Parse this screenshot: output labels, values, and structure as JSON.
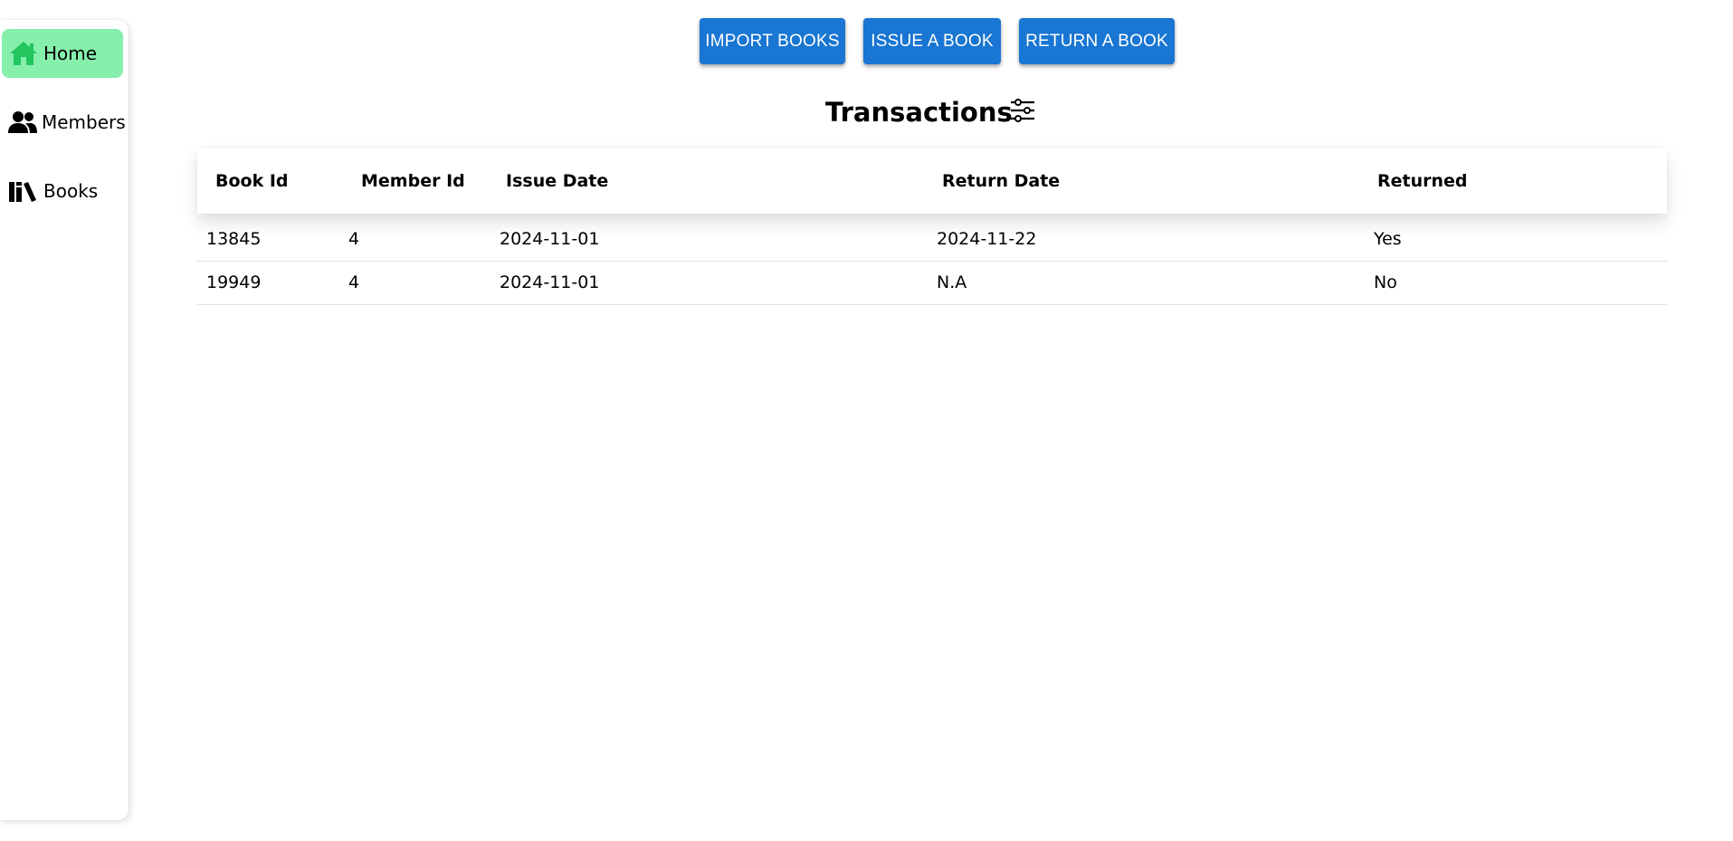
{
  "sidebar": {
    "items": [
      {
        "label": "Home",
        "icon": "home-icon",
        "active": true
      },
      {
        "label": "Members",
        "icon": "members-icon",
        "active": false
      },
      {
        "label": "Books",
        "icon": "books-icon",
        "active": false
      }
    ]
  },
  "toolbar": {
    "import_label": "IMPORT BOOKS",
    "issue_label": "ISSUE A BOOK",
    "return_label": "RETURN A BOOK"
  },
  "main": {
    "title": "Transactions",
    "filter_icon": "filter-sliders-icon"
  },
  "table": {
    "headers": [
      "Book Id",
      "Member Id",
      "Issue Date",
      "Return Date",
      "Returned"
    ],
    "rows": [
      [
        "13845",
        "4",
        "2024-11-01",
        "2024-11-22",
        "Yes"
      ],
      [
        "19949",
        "4",
        "2024-11-01",
        "N.A",
        "No"
      ]
    ]
  },
  "colors": {
    "accent": "#1976d2",
    "active_nav": "#86efac",
    "active_icon": "#22c55e"
  }
}
